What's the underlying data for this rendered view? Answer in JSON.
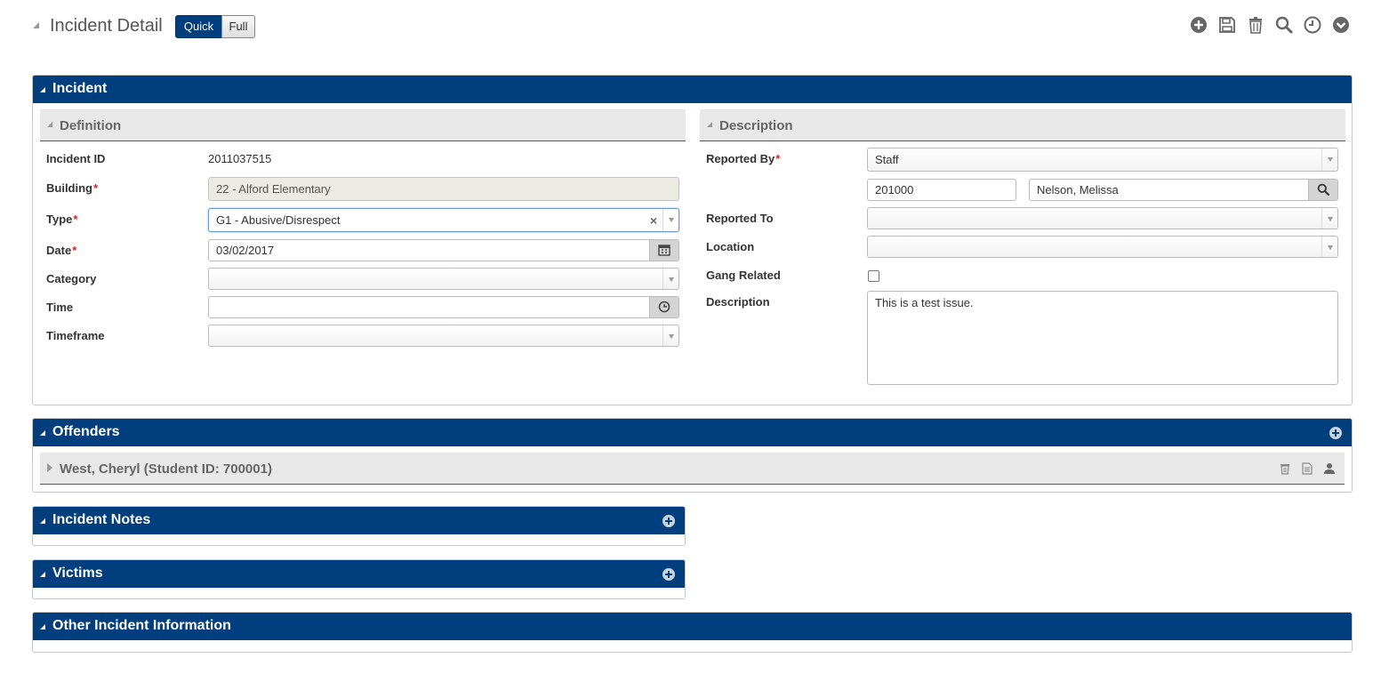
{
  "header": {
    "title": "Incident Detail",
    "view_toggle": {
      "quick": "Quick",
      "full": "Full",
      "selected": "Quick"
    },
    "toolbar_icons": [
      "add-circle-icon",
      "save-icon",
      "trash-icon",
      "search-icon",
      "history-clock-icon",
      "chevron-down-circle-icon"
    ]
  },
  "colors": {
    "panel_header": "#003e7e",
    "required": "#dd2222",
    "subsection": "#e8e8e8"
  },
  "incident": {
    "title": "Incident",
    "definition": {
      "title": "Definition",
      "incident_id": {
        "label": "Incident ID",
        "value": "2011037515"
      },
      "building": {
        "label": "Building",
        "value": "22 - Alford Elementary",
        "required": true
      },
      "type": {
        "label": "Type",
        "value": "G1 - Abusive/Disrespect",
        "required": true
      },
      "date": {
        "label": "Date",
        "value": "03/02/2017",
        "required": true
      },
      "category": {
        "label": "Category",
        "value": ""
      },
      "time": {
        "label": "Time",
        "value": ""
      },
      "timeframe": {
        "label": "Timeframe",
        "value": ""
      }
    },
    "description": {
      "title": "Description",
      "reported_by": {
        "label": "Reported By",
        "value": "Staff",
        "required": true,
        "staff_id": "201000",
        "staff_name": "Nelson, Melissa"
      },
      "reported_to": {
        "label": "Reported To",
        "value": ""
      },
      "location": {
        "label": "Location",
        "value": ""
      },
      "gang_related": {
        "label": "Gang Related",
        "checked": false
      },
      "description": {
        "label": "Description",
        "value": "This is a test issue."
      }
    }
  },
  "offenders": {
    "title": "Offenders",
    "items": [
      {
        "label": "West, Cheryl (Student ID: 700001)"
      }
    ]
  },
  "incident_notes": {
    "title": "Incident Notes"
  },
  "victims": {
    "title": "Victims"
  },
  "other_info": {
    "title": "Other Incident Information"
  }
}
